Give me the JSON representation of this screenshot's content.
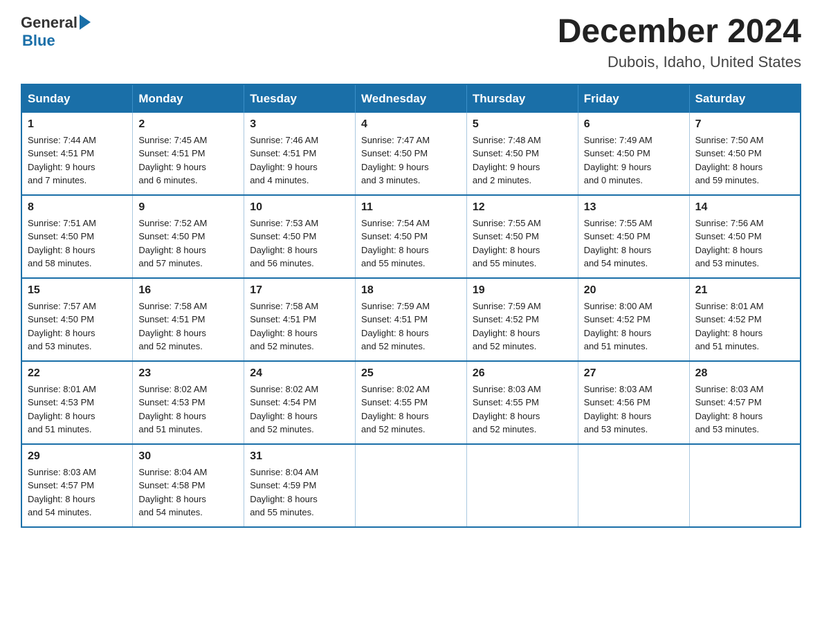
{
  "logo": {
    "general": "General",
    "blue": "Blue"
  },
  "title": "December 2024",
  "subtitle": "Dubois, Idaho, United States",
  "days_of_week": [
    "Sunday",
    "Monday",
    "Tuesday",
    "Wednesday",
    "Thursday",
    "Friday",
    "Saturday"
  ],
  "weeks": [
    [
      {
        "day": "1",
        "sunrise": "7:44 AM",
        "sunset": "4:51 PM",
        "daylight": "9 hours and 7 minutes."
      },
      {
        "day": "2",
        "sunrise": "7:45 AM",
        "sunset": "4:51 PM",
        "daylight": "9 hours and 6 minutes."
      },
      {
        "day": "3",
        "sunrise": "7:46 AM",
        "sunset": "4:51 PM",
        "daylight": "9 hours and 4 minutes."
      },
      {
        "day": "4",
        "sunrise": "7:47 AM",
        "sunset": "4:50 PM",
        "daylight": "9 hours and 3 minutes."
      },
      {
        "day": "5",
        "sunrise": "7:48 AM",
        "sunset": "4:50 PM",
        "daylight": "9 hours and 2 minutes."
      },
      {
        "day": "6",
        "sunrise": "7:49 AM",
        "sunset": "4:50 PM",
        "daylight": "9 hours and 0 minutes."
      },
      {
        "day": "7",
        "sunrise": "7:50 AM",
        "sunset": "4:50 PM",
        "daylight": "8 hours and 59 minutes."
      }
    ],
    [
      {
        "day": "8",
        "sunrise": "7:51 AM",
        "sunset": "4:50 PM",
        "daylight": "8 hours and 58 minutes."
      },
      {
        "day": "9",
        "sunrise": "7:52 AM",
        "sunset": "4:50 PM",
        "daylight": "8 hours and 57 minutes."
      },
      {
        "day": "10",
        "sunrise": "7:53 AM",
        "sunset": "4:50 PM",
        "daylight": "8 hours and 56 minutes."
      },
      {
        "day": "11",
        "sunrise": "7:54 AM",
        "sunset": "4:50 PM",
        "daylight": "8 hours and 55 minutes."
      },
      {
        "day": "12",
        "sunrise": "7:55 AM",
        "sunset": "4:50 PM",
        "daylight": "8 hours and 55 minutes."
      },
      {
        "day": "13",
        "sunrise": "7:55 AM",
        "sunset": "4:50 PM",
        "daylight": "8 hours and 54 minutes."
      },
      {
        "day": "14",
        "sunrise": "7:56 AM",
        "sunset": "4:50 PM",
        "daylight": "8 hours and 53 minutes."
      }
    ],
    [
      {
        "day": "15",
        "sunrise": "7:57 AM",
        "sunset": "4:50 PM",
        "daylight": "8 hours and 53 minutes."
      },
      {
        "day": "16",
        "sunrise": "7:58 AM",
        "sunset": "4:51 PM",
        "daylight": "8 hours and 52 minutes."
      },
      {
        "day": "17",
        "sunrise": "7:58 AM",
        "sunset": "4:51 PM",
        "daylight": "8 hours and 52 minutes."
      },
      {
        "day": "18",
        "sunrise": "7:59 AM",
        "sunset": "4:51 PM",
        "daylight": "8 hours and 52 minutes."
      },
      {
        "day": "19",
        "sunrise": "7:59 AM",
        "sunset": "4:52 PM",
        "daylight": "8 hours and 52 minutes."
      },
      {
        "day": "20",
        "sunrise": "8:00 AM",
        "sunset": "4:52 PM",
        "daylight": "8 hours and 51 minutes."
      },
      {
        "day": "21",
        "sunrise": "8:01 AM",
        "sunset": "4:52 PM",
        "daylight": "8 hours and 51 minutes."
      }
    ],
    [
      {
        "day": "22",
        "sunrise": "8:01 AM",
        "sunset": "4:53 PM",
        "daylight": "8 hours and 51 minutes."
      },
      {
        "day": "23",
        "sunrise": "8:02 AM",
        "sunset": "4:53 PM",
        "daylight": "8 hours and 51 minutes."
      },
      {
        "day": "24",
        "sunrise": "8:02 AM",
        "sunset": "4:54 PM",
        "daylight": "8 hours and 52 minutes."
      },
      {
        "day": "25",
        "sunrise": "8:02 AM",
        "sunset": "4:55 PM",
        "daylight": "8 hours and 52 minutes."
      },
      {
        "day": "26",
        "sunrise": "8:03 AM",
        "sunset": "4:55 PM",
        "daylight": "8 hours and 52 minutes."
      },
      {
        "day": "27",
        "sunrise": "8:03 AM",
        "sunset": "4:56 PM",
        "daylight": "8 hours and 53 minutes."
      },
      {
        "day": "28",
        "sunrise": "8:03 AM",
        "sunset": "4:57 PM",
        "daylight": "8 hours and 53 minutes."
      }
    ],
    [
      {
        "day": "29",
        "sunrise": "8:03 AM",
        "sunset": "4:57 PM",
        "daylight": "8 hours and 54 minutes."
      },
      {
        "day": "30",
        "sunrise": "8:04 AM",
        "sunset": "4:58 PM",
        "daylight": "8 hours and 54 minutes."
      },
      {
        "day": "31",
        "sunrise": "8:04 AM",
        "sunset": "4:59 PM",
        "daylight": "8 hours and 55 minutes."
      },
      null,
      null,
      null,
      null
    ]
  ],
  "labels": {
    "sunrise": "Sunrise:",
    "sunset": "Sunset:",
    "daylight": "Daylight:"
  }
}
